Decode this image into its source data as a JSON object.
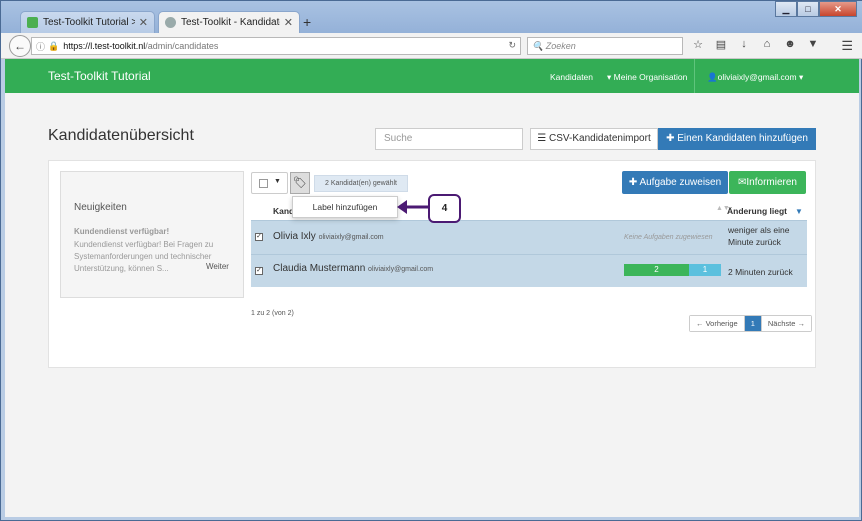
{
  "browser": {
    "tabs": [
      {
        "label": "Test-Toolkit Tutorial > Ixly",
        "favicon": "ixly-icon"
      },
      {
        "label": "Test-Toolkit - Kandidatenü…",
        "favicon": "page-icon"
      }
    ],
    "url_host": "https://l.test-toolkit.nl",
    "url_path": "/admin/candidates",
    "search_placeholder": "Zoeken"
  },
  "nav": {
    "brand": "Test-Toolkit Tutorial",
    "kandidaten": "Kandidaten",
    "org": "Meine Organisation",
    "user": "oliviaixly@gmail.com"
  },
  "header": {
    "title": "Kandidatenübersicht",
    "search_placeholder": "Suche",
    "csv_label": "CSV-Kandidatenimport",
    "add_label": "Einen Kandidaten hinzufügen"
  },
  "news": {
    "title": "Neuigkeiten",
    "headline": "Kundendienst verfügbar!",
    "body": "Kundendienst verfügbar! Bei Fragen zu Systemanforderungen und technischer Unterstützung, können S...",
    "more": "Weiter"
  },
  "toolbar": {
    "selected": "2 Kandidat(en) gewählt",
    "assign_label": "Aufgabe zuweisen",
    "inform_label": "Informieren",
    "dropdown_item": "Label hinzufügen"
  },
  "table": {
    "col_name": "Kand",
    "col_change": "Änderung liegt",
    "rows": [
      {
        "name": "Olivia Ixly",
        "email": "oliviaixly@gmail.com",
        "status": "Keine Aufgaben zugewiesen",
        "change": "weniger als eine Minute zurück",
        "checked": true
      },
      {
        "name": "Claudia Mustermann",
        "email": "oliviaixly@gmail.com",
        "progress_green": "2",
        "progress_blue": "1",
        "change": "2 Minuten zurück",
        "checked": true
      }
    ]
  },
  "pagination": {
    "summary": "1 zu 2 (von 2)",
    "prev": "← Vorherige",
    "page": "1",
    "next": "Nächste →"
  },
  "annotation": {
    "number": "4"
  },
  "colors": {
    "green": "#33ad55",
    "blue": "#337ab7",
    "row": "#c4d8e7",
    "callout": "#4b1a73"
  }
}
